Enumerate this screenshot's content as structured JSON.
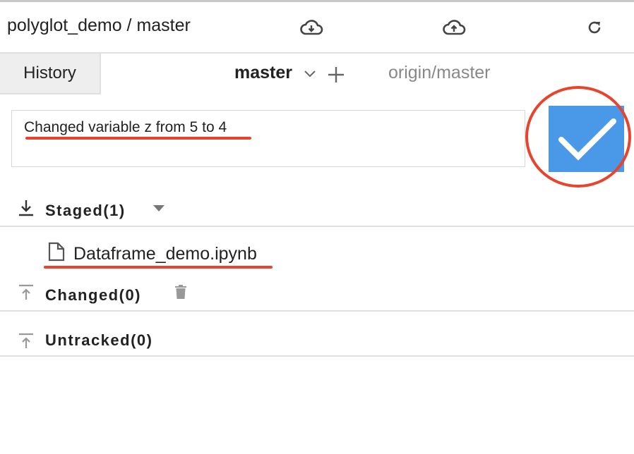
{
  "header": {
    "title": "polyglot_demo / master",
    "icons": [
      "cloud-download-icon",
      "cloud-upload-icon",
      "refresh-icon"
    ]
  },
  "tabs": {
    "history_label": "History",
    "current_branch": "master",
    "remote_branch": "origin/master"
  },
  "commit": {
    "message": "Changed variable z from 5 to 4",
    "button_icon": "checkmark-icon",
    "accent_color": "#4a98e8",
    "annotation_color": "#e8432c"
  },
  "sections": {
    "staged": {
      "label": "Staged(1)",
      "files": [
        "Dataframe_demo.ipynb"
      ]
    },
    "changed": {
      "label": "Changed(0)"
    },
    "untracked": {
      "label": "Untracked(0)"
    }
  }
}
